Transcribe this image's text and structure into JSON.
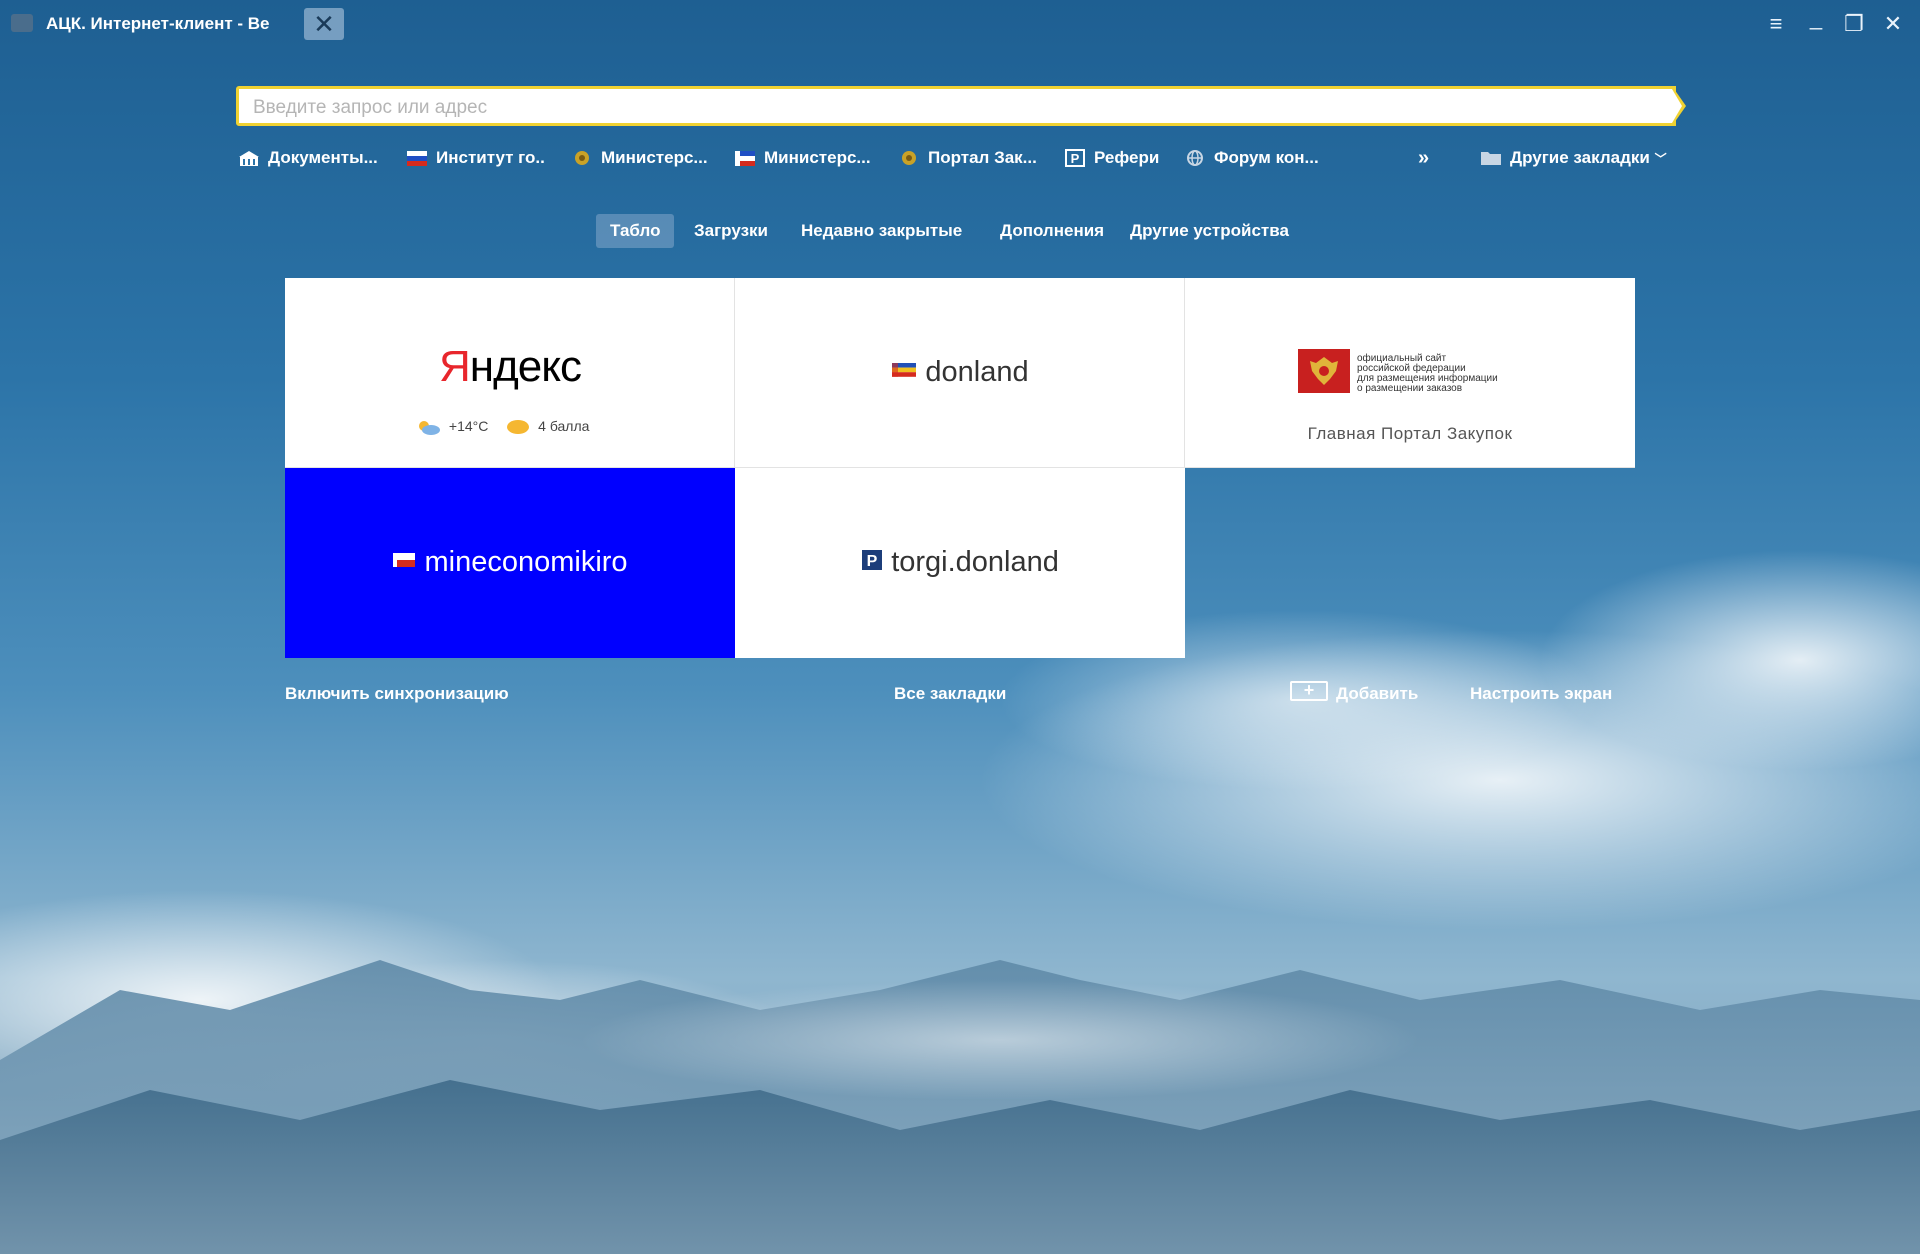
{
  "tab": {
    "title": "АЦК. Интернет-клиент - Ве",
    "close_glyph": "✕"
  },
  "window_controls": {
    "menu": "≡",
    "minimize": "_",
    "restore": "❐",
    "close": "✕"
  },
  "address_bar": {
    "placeholder": "Введите запрос или адрес",
    "value": ""
  },
  "bookmarks": {
    "items": [
      {
        "label": "Документы...",
        "icon": "building-icon"
      },
      {
        "label": "Институт го..",
        "icon": "russia-flag-icon"
      },
      {
        "label": "Министерс...",
        "icon": "emblem-icon"
      },
      {
        "label": "Министерс...",
        "icon": "region-flag-icon"
      },
      {
        "label": "Портал Зак...",
        "icon": "emblem-icon"
      },
      {
        "label": "Рефери",
        "icon": "p-icon"
      },
      {
        "label": "Форум кон...",
        "icon": "globe-icon"
      }
    ],
    "more_glyph": "»",
    "other_label": "Другие закладки",
    "other_chevron": "﹀"
  },
  "nav_tabs": [
    {
      "label": "Табло",
      "active": true
    },
    {
      "label": "Загрузки",
      "active": false
    },
    {
      "label": "Недавно закрытые",
      "active": false
    },
    {
      "label": "Дополнения",
      "active": false
    },
    {
      "label": "Другие устройства",
      "active": false
    }
  ],
  "tiles": {
    "yandex": {
      "logo_first": "Я",
      "logo_rest": "ндекс",
      "temperature": "+14°C",
      "traffic": "4 балла"
    },
    "donland": {
      "label": "donland"
    },
    "zakupki": {
      "logo_lines": [
        "официальный сайт",
        "российской федерации",
        "для размещения информации",
        "о размещении заказов"
      ],
      "caption": "Главная Портал Закупок"
    },
    "mineconomikiro": {
      "label": "mineconomikiro"
    },
    "torgi": {
      "label": "torgi.donland"
    }
  },
  "bottom_links": {
    "sync": "Включить синхронизацию",
    "all_bookmarks": "Все закладки",
    "add_glyph": "+",
    "add": "Добавить",
    "customize": "Настроить экран"
  },
  "colors": {
    "address_border": "#f0d232",
    "mineconomikiro_tile": "#0000ff",
    "yandex_red": "#e8262c"
  }
}
